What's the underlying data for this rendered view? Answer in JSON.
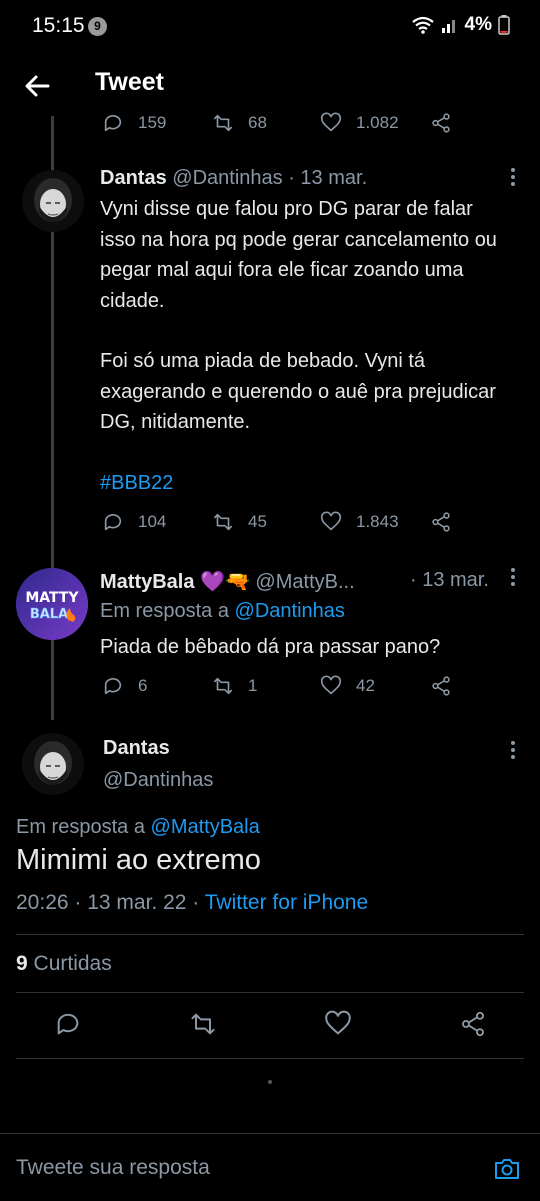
{
  "status": {
    "time": "15:15",
    "notif_count": "9",
    "battery": "4%"
  },
  "appbar": {
    "title": "Tweet"
  },
  "prev_actions": {
    "replies": "159",
    "retweets": "68",
    "likes": "1.082"
  },
  "tweet1": {
    "name": "Dantas",
    "handle": "@Dantinhas",
    "date": "· 13 mar.",
    "para1": "Vyni disse que falou pro DG parar de falar isso na hora pq pode gerar cancelamento ou pegar mal aqui fora ele ficar zoando uma cidade.",
    "para2": "Foi só uma piada de bebado. Vyni tá exagerando e querendo o auê pra prejudicar DG, nitidamente.",
    "hashtag": "#BBB22",
    "replies": "104",
    "retweets": "45",
    "likes": "1.843"
  },
  "tweet2": {
    "name": "MattyBala",
    "emojis": "💜🔫",
    "handle": "@MattyB...",
    "date": "· 13 mar.",
    "replying_prefix": "Em resposta a",
    "replying_to": "@Dantinhas",
    "text": "Piada de bêbado dá pra passar pano?",
    "avatar_text_top": "MATTY",
    "avatar_text_bottom": "BALA",
    "replies": "6",
    "retweets": "1",
    "likes": "42"
  },
  "main_tweet": {
    "name": "Dantas",
    "handle": "@Dantinhas",
    "replying_prefix": "Em resposta a",
    "replying_to": "@MattyBala",
    "text": "Mimimi ao extremo",
    "timestamp": "20:26 · 13 mar. 22 ·",
    "source": "Twitter for iPhone",
    "likes_count": "9",
    "likes_label": "Curtidas"
  },
  "reply_bar": {
    "placeholder": "Tweete sua resposta"
  },
  "colors": {
    "accent": "#1d9bf0",
    "background": "#000000",
    "muted": "#8b98a5"
  },
  "icons": [
    "back-arrow-icon",
    "reply-icon",
    "retweet-icon",
    "like-icon",
    "share-icon",
    "more-icon",
    "camera-icon",
    "wifi-icon",
    "signal-icon",
    "battery-icon"
  ]
}
